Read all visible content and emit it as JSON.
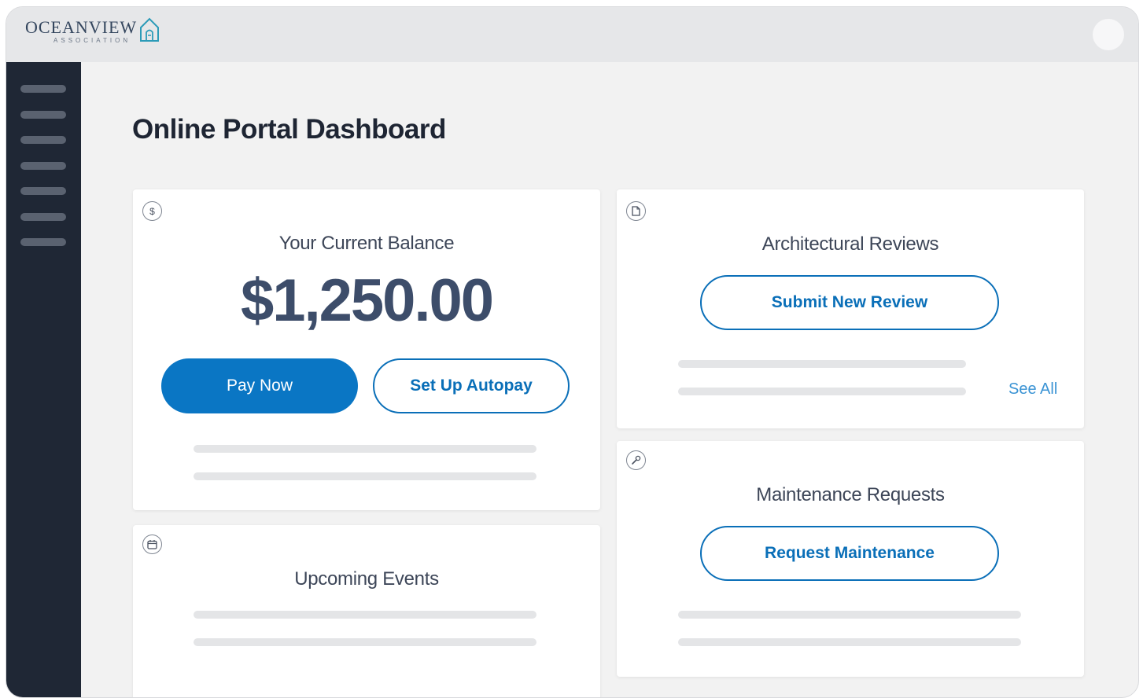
{
  "app": {
    "logo_name": "OCEANVIEW",
    "logo_sub": "ASSOCIATION",
    "accent_color": "#0a76c4",
    "sidebar_color": "#1f2735"
  },
  "page": {
    "title": "Online Portal Dashboard"
  },
  "balance_card": {
    "icon": "dollar-icon",
    "title": "Your Current Balance",
    "amount": "$1,250.00",
    "pay_label": "Pay Now",
    "autopay_label": "Set Up Autopay"
  },
  "reviews_card": {
    "icon": "document-icon",
    "title": "Architectural Reviews",
    "submit_label": "Submit New Review",
    "see_all_label": "See All"
  },
  "maintenance_card": {
    "icon": "wrench-icon",
    "title": "Maintenance Requests",
    "request_label": "Request Maintenance"
  },
  "events_card": {
    "icon": "calendar-icon",
    "title": "Upcoming Events"
  }
}
